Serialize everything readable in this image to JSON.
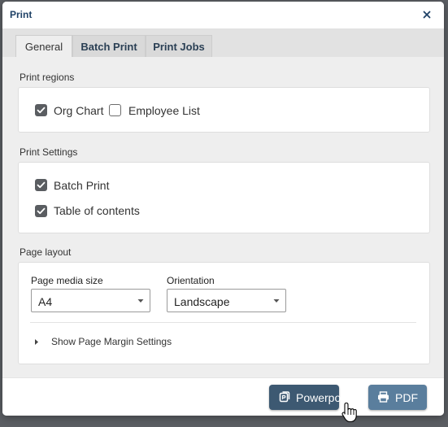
{
  "dialog": {
    "title": "Print"
  },
  "tabs": [
    {
      "label": "General"
    },
    {
      "label": "Batch Print"
    },
    {
      "label": "Print Jobs"
    }
  ],
  "print_regions": {
    "heading": "Print regions",
    "org_chart": {
      "label": "Org Chart",
      "checked": true
    },
    "employee_list": {
      "label": "Employee List",
      "checked": false
    }
  },
  "print_settings": {
    "heading": "Print Settings",
    "batch_print": {
      "label": "Batch Print",
      "checked": true
    },
    "table_of_contents": {
      "label": "Table of contents",
      "checked": true
    }
  },
  "page_layout": {
    "heading": "Page layout",
    "media_size": {
      "label": "Page media size",
      "value": "A4"
    },
    "orientation": {
      "label": "Orientation",
      "value": "Landscape"
    },
    "margin_toggle": "Show Page Margin Settings"
  },
  "footer": {
    "powerpoint_label": "Powerpoint",
    "pdf_label": "PDF"
  },
  "colors": {
    "title": "#1f4166",
    "primary_button": "#3d5972",
    "secondary_button": "#5a7e9d",
    "checkbox": "#5a5d61"
  }
}
